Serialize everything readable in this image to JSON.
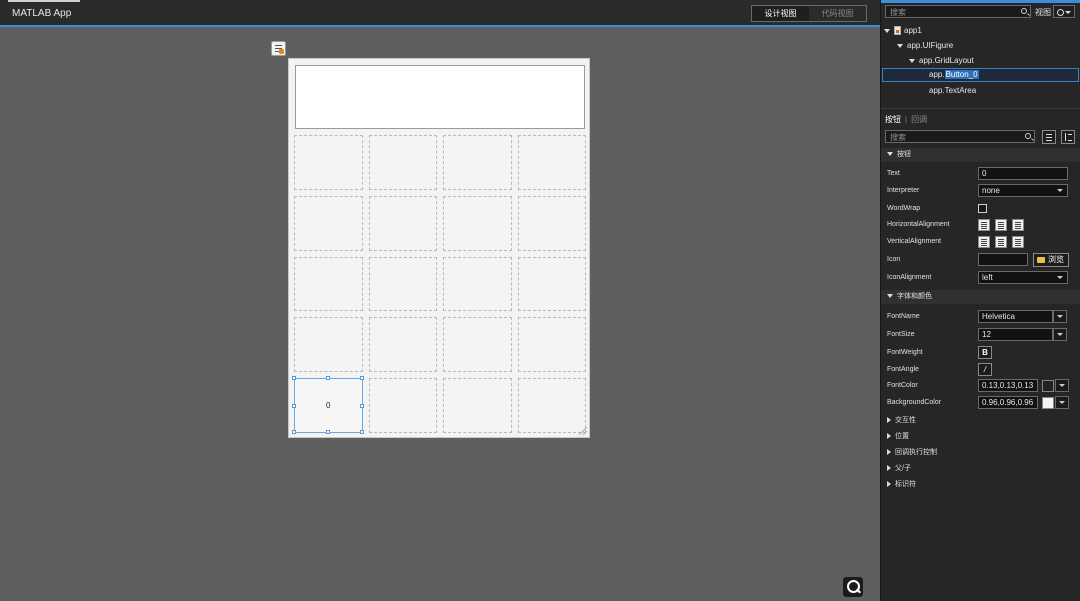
{
  "app": {
    "title": "MATLAB App"
  },
  "view_switch": {
    "design": "设计视图",
    "code": "代码视图"
  },
  "canvas": {
    "button_text": "0",
    "grid_rows": 5,
    "grid_cols": 4,
    "selected_cell_index": 16
  },
  "panel": {
    "search_placeholder": "搜索",
    "view_label": "视图",
    "tree": {
      "root": "app1",
      "figure": "app.UIFigure",
      "grid": "app.GridLayout",
      "button_prefix": "app.",
      "button_selected": "Button_0",
      "textarea": "app.TextArea"
    },
    "tabs": {
      "active": "按钮",
      "inactive": "回调"
    },
    "prop_search_placeholder": "搜索",
    "sections": {
      "button": "按钮",
      "font": "字体和颜色",
      "interactivity": "交互性",
      "position": "位置",
      "callback": "回调执行控制",
      "parent_child": "父/子",
      "identifier": "标识符"
    },
    "props": {
      "text_label": "Text",
      "text_value": "0",
      "interpreter_label": "Interpreter",
      "interpreter_value": "none",
      "wordwrap_label": "WordWrap",
      "halign_label": "HorizontalAlignment",
      "valign_label": "VerticalAlignment",
      "icon_label": "Icon",
      "icon_value": "",
      "browse_label": "浏览",
      "iconalign_label": "IconAlignment",
      "iconalign_value": "left",
      "fontname_label": "FontName",
      "fontname_value": "Helvetica",
      "fontsize_label": "FontSize",
      "fontsize_value": "12",
      "fontweight_label": "FontWeight",
      "fontweight_glyph": "B",
      "fontangle_label": "FontAngle",
      "fontangle_glyph": "/",
      "fontcolor_label": "FontColor",
      "fontcolor_value": "0.13,0.13,0.13",
      "fontcolor_swatch": "#212121",
      "bgcolor_label": "BackgroundColor",
      "bgcolor_value": "0.96,0.96,0.96",
      "bgcolor_swatch": "#f5f5f5"
    }
  },
  "colors": {
    "accent": "#3b8ed8",
    "panel_bg": "#262626",
    "canvas_bg": "#5f5f5f"
  }
}
